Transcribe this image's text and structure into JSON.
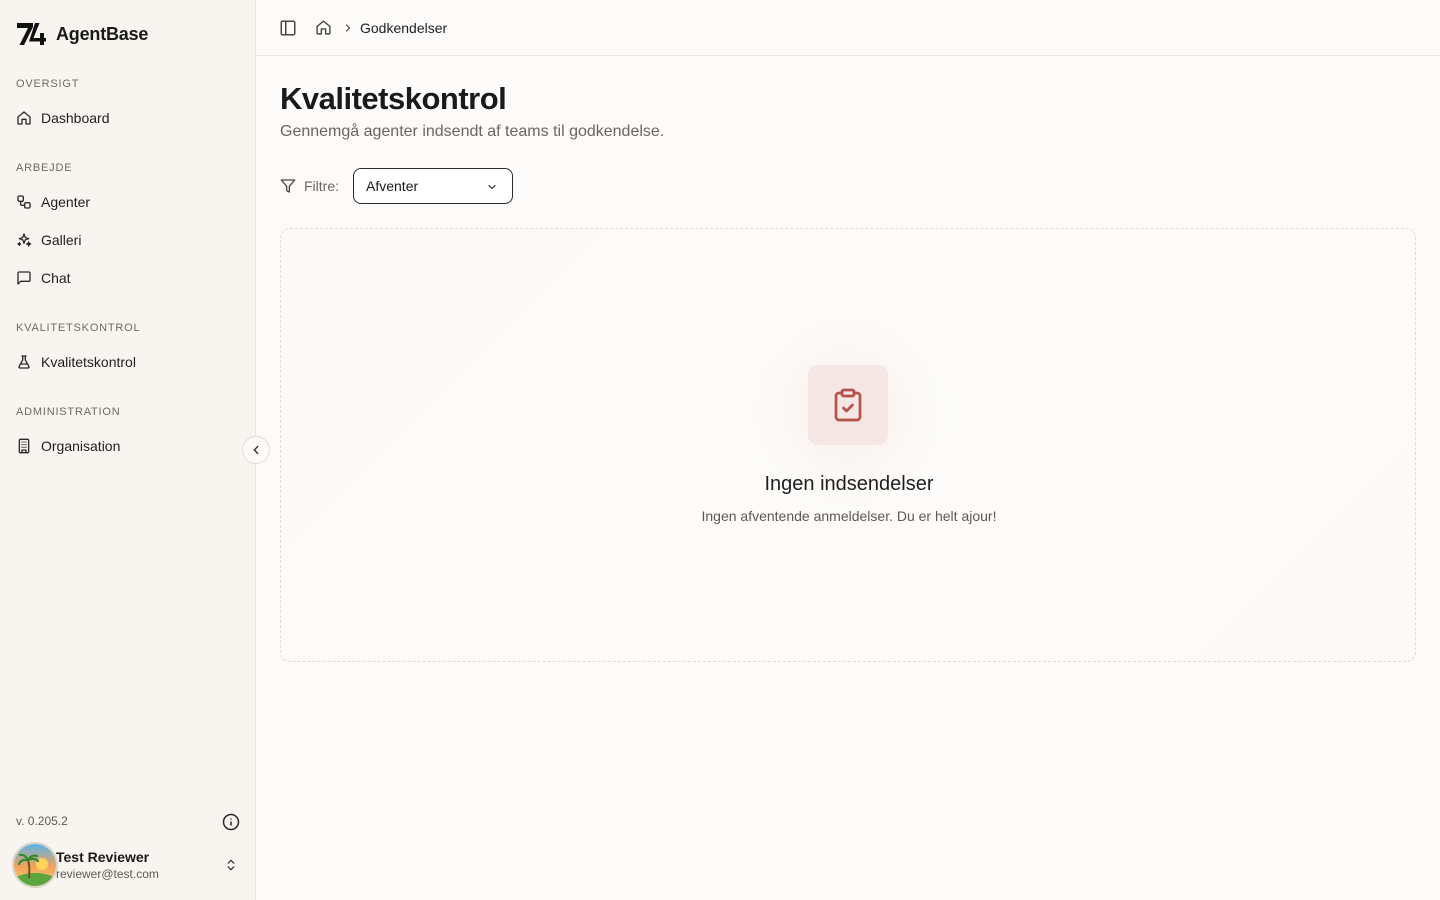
{
  "app": {
    "name": "AgentBase",
    "version": "v. 0.205.2"
  },
  "sidebar": {
    "sections": [
      {
        "label": "OVERSIGT",
        "items": [
          {
            "label": "Dashboard",
            "icon": "home-icon"
          }
        ]
      },
      {
        "label": "ARBEJDE",
        "items": [
          {
            "label": "Agenter",
            "icon": "workflow-icon"
          },
          {
            "label": "Galleri",
            "icon": "sparkles-icon"
          },
          {
            "label": "Chat",
            "icon": "message-square-icon"
          }
        ]
      },
      {
        "label": "KVALITETSKONTROL",
        "items": [
          {
            "label": "Kvalitetskontrol",
            "icon": "flask-icon"
          }
        ]
      },
      {
        "label": "ADMINISTRATION",
        "items": [
          {
            "label": "Organisation",
            "icon": "building-icon"
          }
        ]
      }
    ]
  },
  "user": {
    "name": "Test Reviewer",
    "email": "reviewer@test.com"
  },
  "breadcrumb": {
    "current": "Godkendelser"
  },
  "page": {
    "title": "Kvalitetskontrol",
    "subtitle": "Gennemgå agenter indsendt af teams til godkendelse."
  },
  "filter": {
    "label": "Filtre:",
    "selected": "Afventer"
  },
  "empty_state": {
    "title": "Ingen indsendelser",
    "text": "Ingen afventende anmeldelser. Du er helt ajour!"
  },
  "colors": {
    "accent": "#b5524a",
    "accent_bg": "#f6e7e4",
    "sidebar_bg": "#f8f5f1"
  }
}
